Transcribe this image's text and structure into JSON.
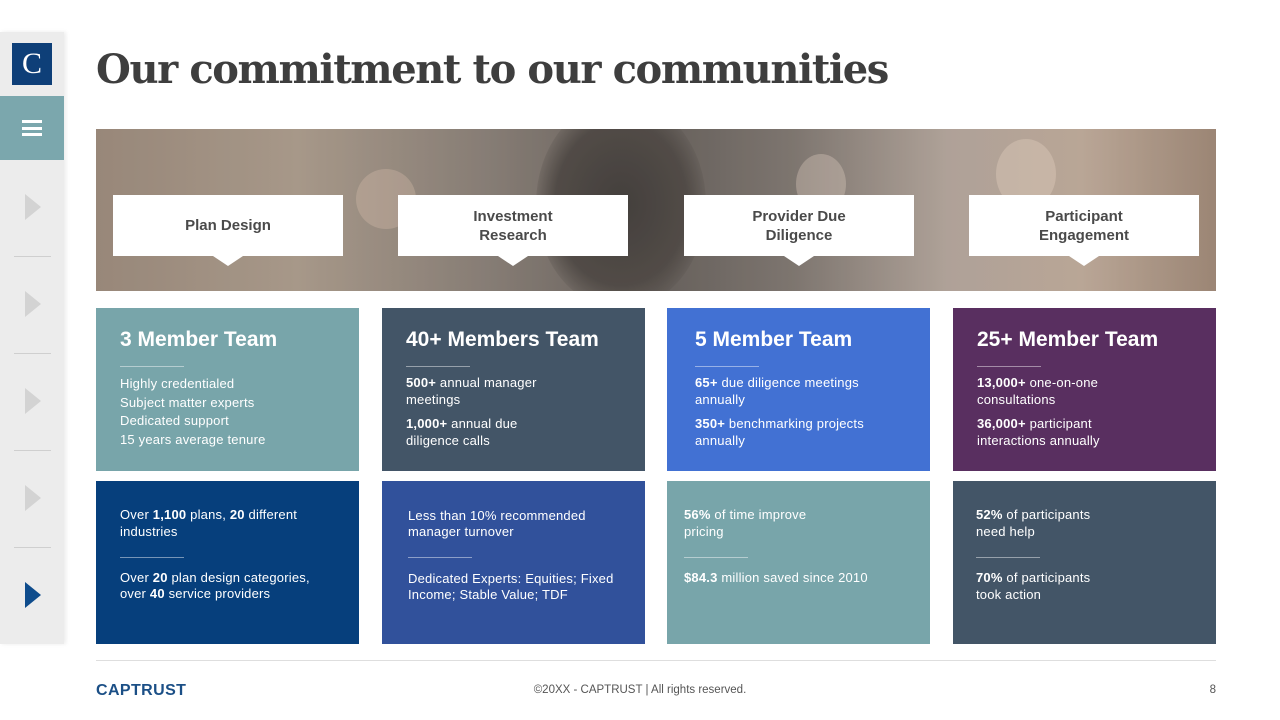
{
  "sidebar": {
    "logo_letter": "C",
    "nav_arrow_count": 5,
    "active_index": 4
  },
  "title": "Our commitment to our communities",
  "banner": {
    "callouts": [
      {
        "label": "Plan Design"
      },
      {
        "label": "Investment\nResearch"
      },
      {
        "label": "Provider Due\nDiligence"
      },
      {
        "label": "Participant\nEngagement"
      }
    ]
  },
  "teams": [
    {
      "heading": "3 Member Team",
      "color": "#78a5aa",
      "lines": [
        "Highly credentialed",
        "Subject matter experts",
        "Dedicated support",
        "15 years average tenure"
      ]
    },
    {
      "heading": "40+ Members Team",
      "color": "#435567",
      "items": [
        {
          "strong": "500+",
          "rest": " annual manager",
          "cont": "meetings"
        },
        {
          "strong": "1,000+",
          "rest": " annual due",
          "cont": "diligence calls"
        }
      ]
    },
    {
      "heading": "5 Member Team",
      "color": "#4271d3",
      "items": [
        {
          "strong": "65+",
          "rest": " due diligence meetings",
          "cont": "annually"
        },
        {
          "strong": "350+",
          "rest": " benchmarking projects",
          "cont": "annually"
        }
      ]
    },
    {
      "heading": "25+ Member Team",
      "color": "#592f60",
      "items": [
        {
          "strong": "13,000+",
          "rest": " one-on-one",
          "cont": "consultations"
        },
        {
          "strong": "36,000+",
          "rest": " participant",
          "cont": "interactions annually"
        }
      ]
    }
  ],
  "stats": [
    {
      "color": "#063f7c",
      "top": {
        "p1": "Over ",
        "b1": "1,100",
        "p2": " plans, ",
        "b2": "20",
        "p3": " different",
        "cont": "industries"
      },
      "bottom": {
        "p1": "Over ",
        "b1": "20",
        "p2": " plan design categories,",
        "cont_p1": "over ",
        "cont_b1": "40",
        "cont_p2": " service providers"
      }
    },
    {
      "color": "#31519b",
      "top": {
        "l1": "Less than 10% recommended",
        "l2": "manager turnover"
      },
      "bottom": {
        "l1": "Dedicated Experts: Equities; Fixed",
        "l2": "Income; Stable Value; TDF"
      }
    },
    {
      "color": "#78a5aa",
      "top": {
        "b1": "56%",
        "p1": " of time improve",
        "cont": "pricing"
      },
      "bottom": {
        "b1": "$84.3",
        "p1": " million saved since 2010"
      }
    },
    {
      "color": "#435567",
      "top": {
        "b1": "52%",
        "p1": " of participants",
        "cont": "need help"
      },
      "bottom": {
        "b1": "70%",
        "p1": " of participants",
        "cont": "took action"
      }
    }
  ],
  "footer": {
    "brand": "CAPTRUST",
    "copyright": "©20XX - CAPTRUST | All rights reserved.",
    "page_number": "8"
  }
}
